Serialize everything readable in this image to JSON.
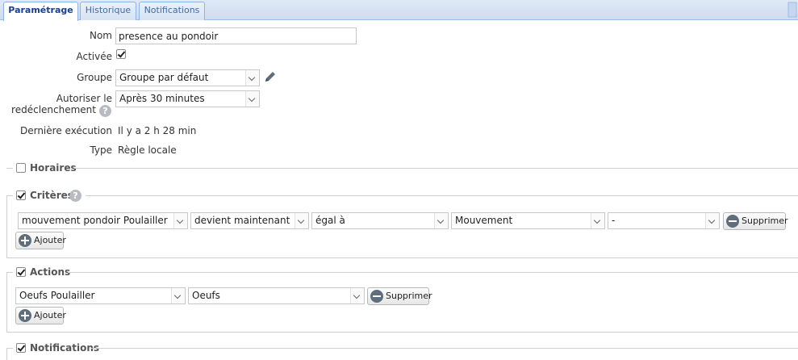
{
  "tabs": [
    {
      "label": "Paramétrage",
      "active": true
    },
    {
      "label": "Historique",
      "active": false
    },
    {
      "label": "Notifications",
      "active": false
    }
  ],
  "form": {
    "nom_label": "Nom",
    "nom_value": "presence au pondoir",
    "activee_label": "Activée",
    "activee_checked": true,
    "groupe_label": "Groupe",
    "groupe_value": "Groupe par défaut",
    "autoriser_label_line1": "Autoriser le",
    "autoriser_label_line2": "redéclenchement",
    "autoriser_value": "Après 30 minutes",
    "derniere_label": "Dernière exécution",
    "derniere_value": "Il y a 2 h 28 min",
    "type_label": "Type",
    "type_value": "Règle locale"
  },
  "sections": {
    "horaires": {
      "title": "Horaires",
      "checked": false
    },
    "criteres": {
      "title": "Critères",
      "checked": true,
      "row": {
        "device": "mouvement pondoir Poulailler",
        "condition": "devient maintenant",
        "operator": "égal à",
        "value": "Mouvement",
        "extra": "-"
      },
      "delete_label": "Supprimer",
      "add_label": "Ajouter"
    },
    "actions": {
      "title": "Actions",
      "checked": true,
      "row": {
        "device": "Oeufs Poulailler",
        "action": "Oeufs"
      },
      "delete_label": "Supprimer",
      "add_label": "Ajouter"
    },
    "notifications": {
      "title": "Notifications",
      "checked": true
    }
  },
  "icons": {
    "help": "?",
    "edit": "pencil-icon"
  },
  "colors": {
    "tab_active_text": "#15428b",
    "tab_border": "#99bbe8",
    "icon_dark": "#5f6d7d"
  }
}
